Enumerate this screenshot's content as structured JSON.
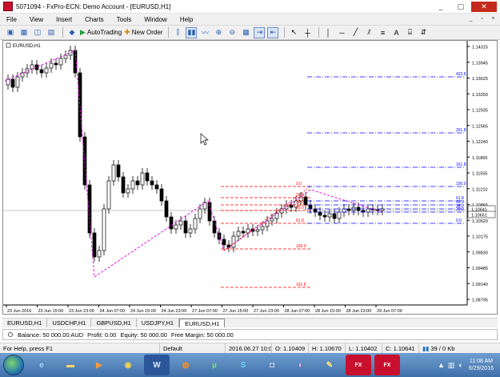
{
  "window": {
    "title": "5071094 - FxPro-ECN: Demo Account - [EURUSD,H1]",
    "minimize": "_",
    "maximize": "▢",
    "close": "✕"
  },
  "menu": {
    "items": [
      "File",
      "View",
      "Insert",
      "Charts",
      "Tools",
      "Window",
      "Help"
    ]
  },
  "toolbar": {
    "autotrading_label": "AutoTrading",
    "new_order_label": "New Order"
  },
  "chart": {
    "label": "EURUSD,H1",
    "y_ticks": [
      "1.14315",
      "1.13945",
      "1.13625",
      "1.13250",
      "1.12935",
      "1.12565",
      "1.12240",
      "1.11865",
      "1.11555",
      "1.11210",
      "1.10865",
      "1.10520",
      "1.10175",
      "1.09830",
      "1.09485",
      "1.09140",
      "1.08795"
    ],
    "price_tags": [
      "1.10641",
      "1.10651"
    ],
    "x_ticks": [
      "23 Jun 2016",
      "23 Jun 15:00",
      "23 Jun 23:00",
      "24 Jun 07:00",
      "24 Jun 15:00",
      "24 Jun 23:00",
      "27 Jun 07:00",
      "27 Jun 15:00",
      "27 Jun 23:00",
      "28 Jun 07:00",
      "28 Jun 15:00",
      "28 Jun 23:00",
      "29 Jun 07:00"
    ],
    "fib_left": [
      "0.0",
      "23.6",
      "38.2",
      "50.0",
      "61.8",
      "100.0",
      "161.8"
    ],
    "fib_right": [
      "423.6",
      "261.8",
      "161.8",
      "100.0",
      "61.8",
      "50.0",
      "38.2",
      "23.6",
      "0.0"
    ],
    "colors": {
      "bull": "#ffffff",
      "bear": "#000000",
      "zigzag": "#e100e1",
      "fib_left": "#ff0000",
      "fib_right": "#0000ff"
    }
  },
  "symbol_tabs": [
    "EURUSD,H1",
    "USDCHF,H1",
    "GBPUSD,H1",
    "USDJPY,H1",
    "EURUSD,H1"
  ],
  "terminal": {
    "balance": "Balance: 50 000.00 AUD",
    "profit": "Profit: 0.00",
    "equity": "Equity: 50 000.00",
    "free_margin": "Free Margin: 50 000.00"
  },
  "status": {
    "help": "For Help, press F1",
    "profile": "Default",
    "time": "2016.06.27 10:00",
    "open": "O: 1.10409",
    "high": "H: 1.10670",
    "low": "L: 1.10402",
    "close": "C: 1.10641",
    "traffic": "39 / 0 Kb"
  },
  "taskbar": {
    "time": "11:08 AM",
    "date": "6/29/2016",
    "apps": [
      "ie-icon",
      "explorer-icon",
      "media-icon",
      "chrome-icon",
      "word-icon",
      "firefox-icon",
      "utorrent-icon",
      "skype-icon",
      "camera-icon",
      "media-player-icon",
      "paint-icon",
      "fxpro-icon",
      "fxpro-icon"
    ]
  }
}
